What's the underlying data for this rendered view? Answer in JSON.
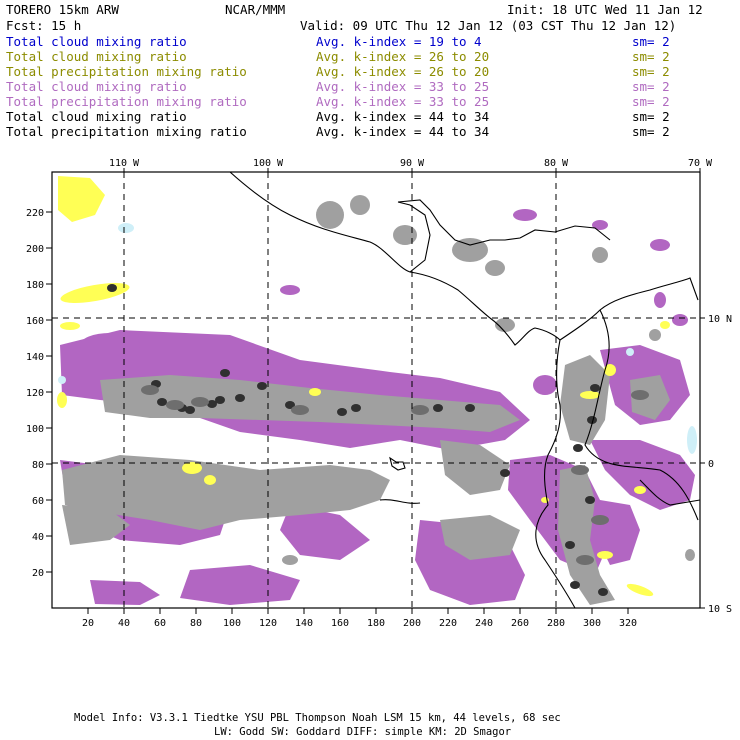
{
  "header": {
    "model": "TORERO  15km ARW",
    "org": "NCAR/MMM",
    "init": "Init: 18 UTC Wed 11 Jan 12",
    "fcst": "Fcst:   15 h",
    "valid": "Valid: 09 UTC Thu 12 Jan 12 (03 CST Thu 12 Jan 12)"
  },
  "legend": [
    {
      "field": "Total cloud mixing ratio",
      "index": "Avg. k-index = 19 to  4",
      "sm": "sm= 2",
      "color": "#0000cc"
    },
    {
      "field": "Total cloud mixing ratio",
      "index": "Avg. k-index = 26 to 20",
      "sm": "sm= 2",
      "color": "#8c8c00"
    },
    {
      "field": "Total precipitation mixing ratio",
      "index": "Avg. k-index = 26 to 20",
      "sm": "sm= 2",
      "color": "#8c8c00"
    },
    {
      "field": "Total cloud mixing ratio",
      "index": "Avg. k-index = 33 to 25",
      "sm": "sm= 2",
      "color": "#b06bc0"
    },
    {
      "field": "Total precipitation mixing ratio",
      "index": "Avg. k-index = 33 to 25",
      "sm": "sm= 2",
      "color": "#b06bc0"
    },
    {
      "field": "Total cloud mixing ratio",
      "index": "Avg. k-index = 44 to 34",
      "sm": "sm= 2",
      "color": "#000000"
    },
    {
      "field": "Total precipitation mixing ratio",
      "index": "Avg. k-index = 44 to 34",
      "sm": "sm= 2",
      "color": "#000000"
    }
  ],
  "axes": {
    "lon_labels": [
      "110 W",
      "100 W",
      "90 W",
      "80 W",
      "70 W"
    ],
    "lat_labels": [
      "10 N",
      "0",
      "10 S"
    ],
    "x_ticks": [
      20,
      40,
      60,
      80,
      100,
      120,
      140,
      160,
      180,
      200,
      220,
      240,
      260,
      280,
      300,
      320
    ],
    "y_ticks": [
      20,
      40,
      60,
      80,
      100,
      120,
      140,
      160,
      180,
      200,
      220
    ]
  },
  "colors": {
    "cloud_low": "#ffff55",
    "cloud_mid": "#b266c2",
    "cloud_high": "#a0a0a0",
    "cloud_dense": "#303030",
    "ice": "#cfeff8"
  },
  "footer": {
    "line1": "Model Info: V3.3.1   Tiedtke YSU PBL  Thompson    Noah LSM  15 km,   44 levels,   68 sec",
    "line2": "LW: Godd SW: Goddard DIFF: simple KM: 2D Smagor"
  }
}
